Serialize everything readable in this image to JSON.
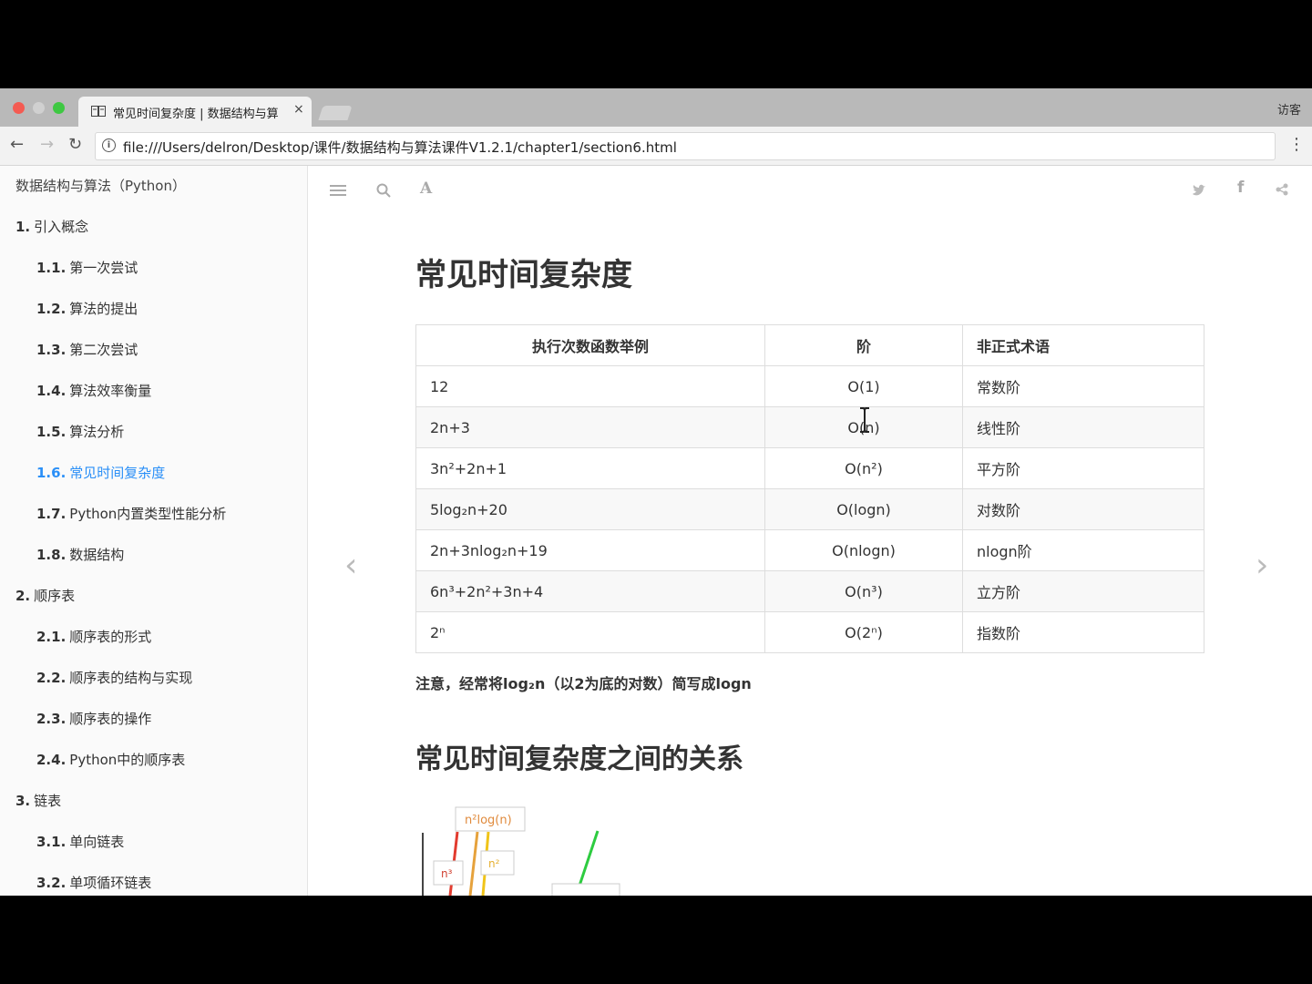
{
  "browser": {
    "tab_title": "常见时间复杂度 | 数据结构与算",
    "tab_close": "×",
    "guest_label": "访客",
    "url": "file:///Users/delron/Desktop/课件/数据结构与算法课件V1.2.1/chapter1/section6.html",
    "nav": {
      "back": "←",
      "forward": "→",
      "reload": "↻",
      "info": "i",
      "menu": "⋮"
    }
  },
  "sidebar": {
    "book_title": "数据结构与算法（Python）",
    "items": [
      {
        "num": "1.",
        "label": "引入概念",
        "level": 1
      },
      {
        "num": "1.1.",
        "label": "第一次尝试",
        "level": 2
      },
      {
        "num": "1.2.",
        "label": "算法的提出",
        "level": 2
      },
      {
        "num": "1.3.",
        "label": "第二次尝试",
        "level": 2
      },
      {
        "num": "1.4.",
        "label": "算法效率衡量",
        "level": 2
      },
      {
        "num": "1.5.",
        "label": "算法分析",
        "level": 2
      },
      {
        "num": "1.6.",
        "label": "常见时间复杂度",
        "level": 2,
        "active": true
      },
      {
        "num": "1.7.",
        "label": "Python内置类型性能分析",
        "level": 2
      },
      {
        "num": "1.8.",
        "label": "数据结构",
        "level": 2
      },
      {
        "num": "2.",
        "label": "顺序表",
        "level": 1
      },
      {
        "num": "2.1.",
        "label": "顺序表的形式",
        "level": 2
      },
      {
        "num": "2.2.",
        "label": "顺序表的结构与实现",
        "level": 2
      },
      {
        "num": "2.3.",
        "label": "顺序表的操作",
        "level": 2
      },
      {
        "num": "2.4.",
        "label": "Python中的顺序表",
        "level": 2
      },
      {
        "num": "3.",
        "label": "链表",
        "level": 1
      },
      {
        "num": "3.1.",
        "label": "单向链表",
        "level": 2
      },
      {
        "num": "3.2.",
        "label": "单项循环链表",
        "level": 2
      }
    ]
  },
  "content": {
    "icons": [
      "menu-icon",
      "search-icon",
      "font-icon",
      "twitter-icon",
      "facebook-icon",
      "share-icon"
    ],
    "font_glyph": "A",
    "facebook_glyph": "f",
    "title": "常见时间复杂度",
    "table": {
      "headers": [
        "执行次数函数举例",
        "阶",
        "非正式术语"
      ],
      "rows": [
        {
          "example": "12",
          "order": "O(1)",
          "term": "常数阶"
        },
        {
          "example": "2n+3",
          "order": "O(n)",
          "term": "线性阶"
        },
        {
          "example": "3n²+2n+1",
          "order": "O(n²)",
          "term": "平方阶"
        },
        {
          "example": "5log₂n+20",
          "order": "O(logn)",
          "term": "对数阶"
        },
        {
          "example": "2n+3nlog₂n+19",
          "order": "O(nlogn)",
          "term": "nlogn阶"
        },
        {
          "example": "6n³+2n²+3n+4",
          "order": "O(n³)",
          "term": "立方阶"
        },
        {
          "example": "2ⁿ",
          "order": "O(2ⁿ)",
          "term": "指数阶"
        }
      ]
    },
    "note": "注意，经常将log₂n（以2为底的对数）简写成logn",
    "subtitle": "常见时间复杂度之间的关系",
    "figure_labels": {
      "top": "n²log(n)",
      "left": "n³",
      "mid": "n²"
    },
    "prev_arrow": "‹",
    "next_arrow": "›"
  }
}
